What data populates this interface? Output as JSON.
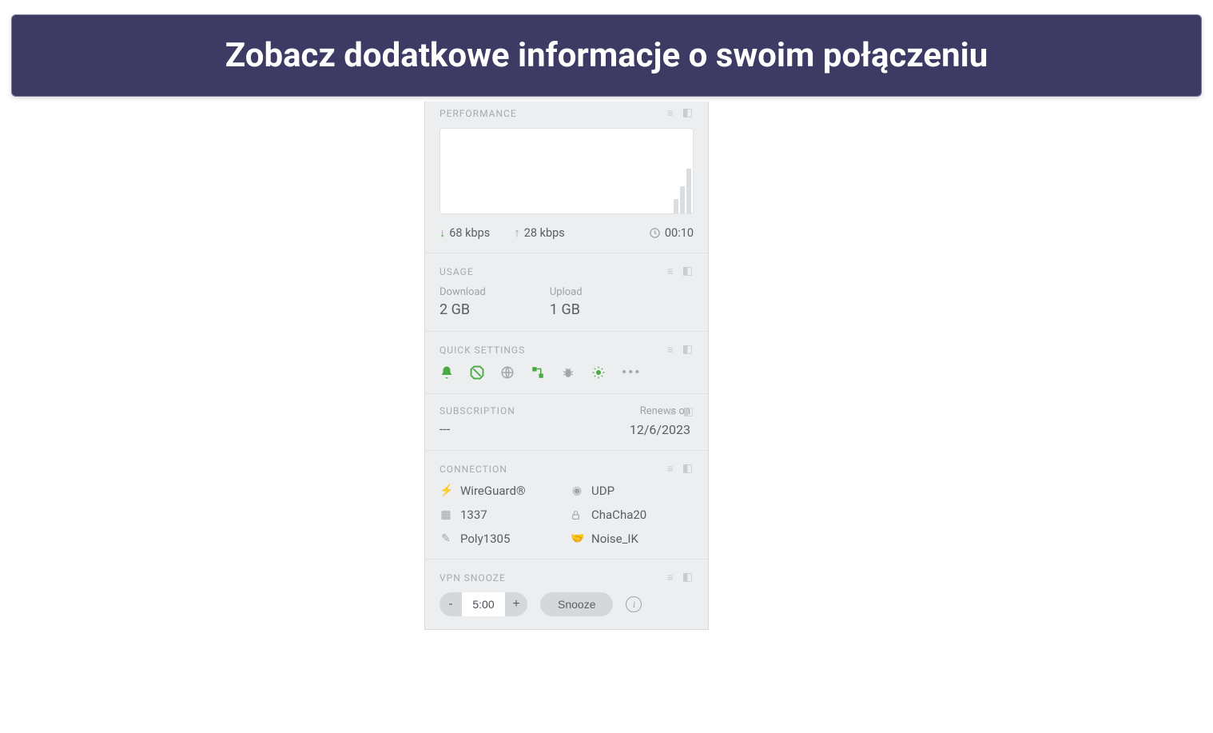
{
  "banner": {
    "title": "Zobacz dodatkowe informacje o swoim połączeniu"
  },
  "performance": {
    "header": "PERFORMANCE",
    "download_rate": "68 kbps",
    "upload_rate": "28 kbps",
    "duration": "00:10"
  },
  "usage": {
    "header": "USAGE",
    "download_label": "Download",
    "download_value": "2 GB",
    "upload_label": "Upload",
    "upload_value": "1 GB"
  },
  "quick_settings": {
    "header": "QUICK SETTINGS",
    "icons": [
      "bell",
      "block",
      "globe",
      "network",
      "bug",
      "light",
      "more"
    ]
  },
  "subscription": {
    "header": "SUBSCRIPTION",
    "plan": "---",
    "renews_label": "Renews on",
    "renews_date": "12/6/2023"
  },
  "connection": {
    "header": "CONNECTION",
    "items": [
      {
        "icon": "plug",
        "value": "WireGuard®"
      },
      {
        "icon": "disk",
        "value": "UDP"
      },
      {
        "icon": "port",
        "value": "1337"
      },
      {
        "icon": "lock",
        "value": "ChaCha20"
      },
      {
        "icon": "key",
        "value": "Poly1305"
      },
      {
        "icon": "hand",
        "value": "Noise_IK"
      }
    ]
  },
  "snooze": {
    "header": "VPN SNOOZE",
    "minus": "-",
    "time": "5:00",
    "plus": "+",
    "button": "Snooze"
  }
}
